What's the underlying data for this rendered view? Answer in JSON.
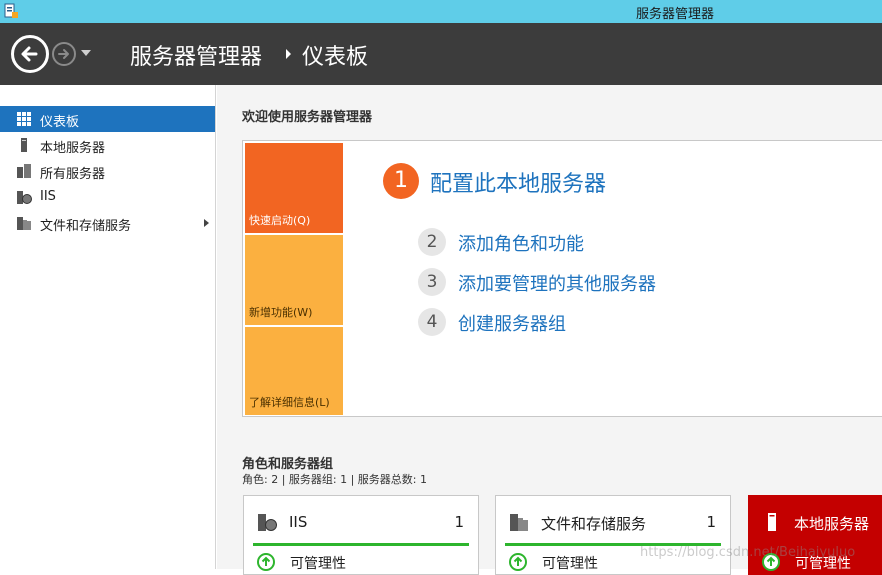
{
  "window": {
    "title": "服务器管理器",
    "icon": "server-manager-icon"
  },
  "header": {
    "breadcrumb": [
      "服务器管理器",
      "仪表板"
    ],
    "back_icon": "back-arrow-icon",
    "forward_icon": "forward-arrow-icon",
    "dropdown_icon": "chevron-down-icon"
  },
  "sidebar": {
    "items": [
      {
        "label": "仪表板",
        "icon": "dashboard-icon",
        "active": true
      },
      {
        "label": "本地服务器",
        "icon": "server-icon"
      },
      {
        "label": "所有服务器",
        "icon": "servers-icon"
      },
      {
        "label": "IIS",
        "icon": "iis-icon"
      },
      {
        "label": "文件和存储服务",
        "icon": "file-storage-icon",
        "has_submenu": true
      }
    ]
  },
  "welcome": {
    "title": "欢迎使用服务器管理器",
    "tiles": [
      "快速启动(Q)",
      "新增功能(W)",
      "了解详细信息(L)"
    ],
    "steps": [
      {
        "num": "1",
        "label": "配置此本地服务器"
      },
      {
        "num": "2",
        "label": "添加角色和功能"
      },
      {
        "num": "3",
        "label": "添加要管理的其他服务器"
      },
      {
        "num": "4",
        "label": "创建服务器组"
      }
    ]
  },
  "roles": {
    "title": "角色和服务器组",
    "subtitle": "角色: 2 | 服务器组: 1 | 服务器总数: 1",
    "cards": [
      {
        "title": "IIS",
        "count": "1",
        "status": "可管理性",
        "color": "#ffffff"
      },
      {
        "title": "文件和存储服务",
        "count": "1",
        "status": "可管理性",
        "color": "#ffffff"
      },
      {
        "title": "本地服务器",
        "count": "",
        "status": "可管理性",
        "color": "#c40000"
      }
    ]
  },
  "watermark": "https://blog.csdn.net/Beihaiyuluo",
  "colors": {
    "titlebar": "#5fcde8",
    "header": "#3c3c3c",
    "accent_blue": "#1e73be",
    "quickstart_orange": "#f26522",
    "tile_yellow": "#fbb040",
    "status_green": "#2db52d",
    "alert_red": "#c40000"
  }
}
